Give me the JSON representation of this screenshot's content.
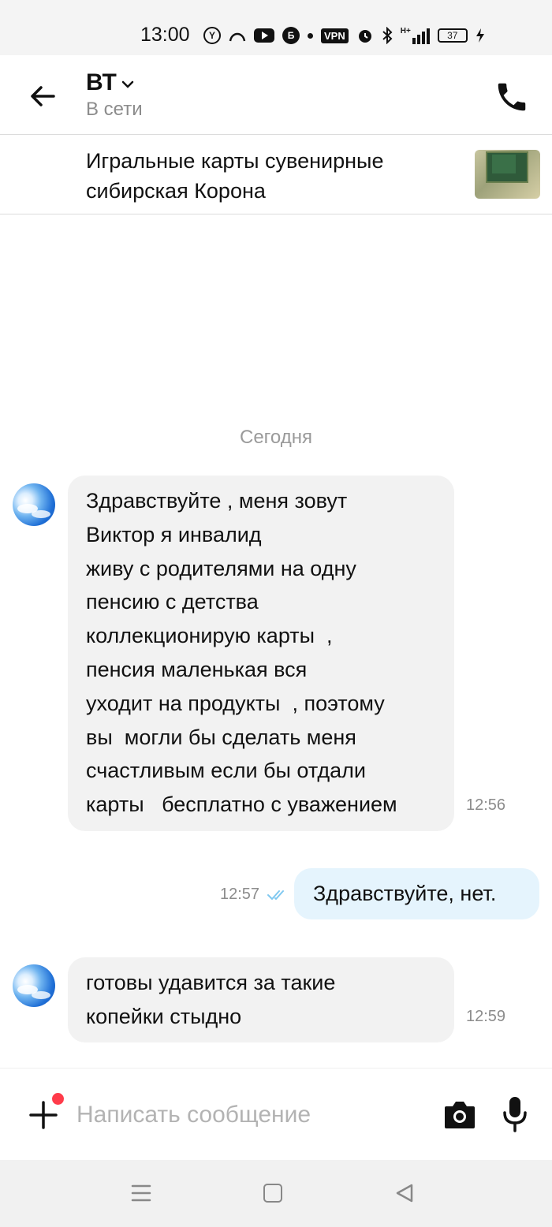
{
  "status_bar": {
    "time": "13:00",
    "icons": [
      "y-circle-icon",
      "arc-icon",
      "youtube-icon",
      "b-circle-icon",
      "dot-icon",
      "vpn-icon",
      "alarm-icon",
      "bluetooth-icon",
      "signal-icon",
      "battery-icon",
      "charging-icon"
    ],
    "y_label": "Y",
    "b_label": "Б",
    "vpn_label": "VPN",
    "signal_label": "H+",
    "battery_level": "37"
  },
  "header": {
    "contact_name": "ВТ",
    "contact_status": "В сети",
    "back_icon": "arrow-left-icon",
    "call_icon": "phone-icon"
  },
  "listing": {
    "title": "Игральные карты сувенирные сибирская Корона",
    "thumbnail": "playing-cards-photo"
  },
  "chat": {
    "date_separator": "Сегодня",
    "messages": [
      {
        "direction": "incoming",
        "lines": [
          "Здравствуйте , меня зовут",
          "Виктор я инвалид",
          "живу с родителями на одну",
          "пенсию с детства",
          "коллекционирую карты  ,",
          "пенсия маленькая вся",
          "уходит на продукты  , поэтому",
          "вы  могли бы сделать меня",
          "счастливым если бы отдали",
          "карты   бесплатно с уважением"
        ],
        "time": "12:56"
      },
      {
        "direction": "outgoing",
        "text": "Здравствуйте, нет.",
        "time": "12:57",
        "status": "read"
      },
      {
        "direction": "incoming",
        "lines": [
          "готовы удавится за такие",
          "копейки стыдно"
        ],
        "time": "12:59"
      }
    ]
  },
  "composer": {
    "placeholder": "Написать сообщение",
    "value": "",
    "has_notification": true,
    "notification_color": "#ff3b4a"
  },
  "colors": {
    "incoming_bubble": "#f2f2f2",
    "outgoing_bubble": "#e5f4fd",
    "read_ticks": "#7fc8f0",
    "muted_text": "#8c8c8c"
  }
}
